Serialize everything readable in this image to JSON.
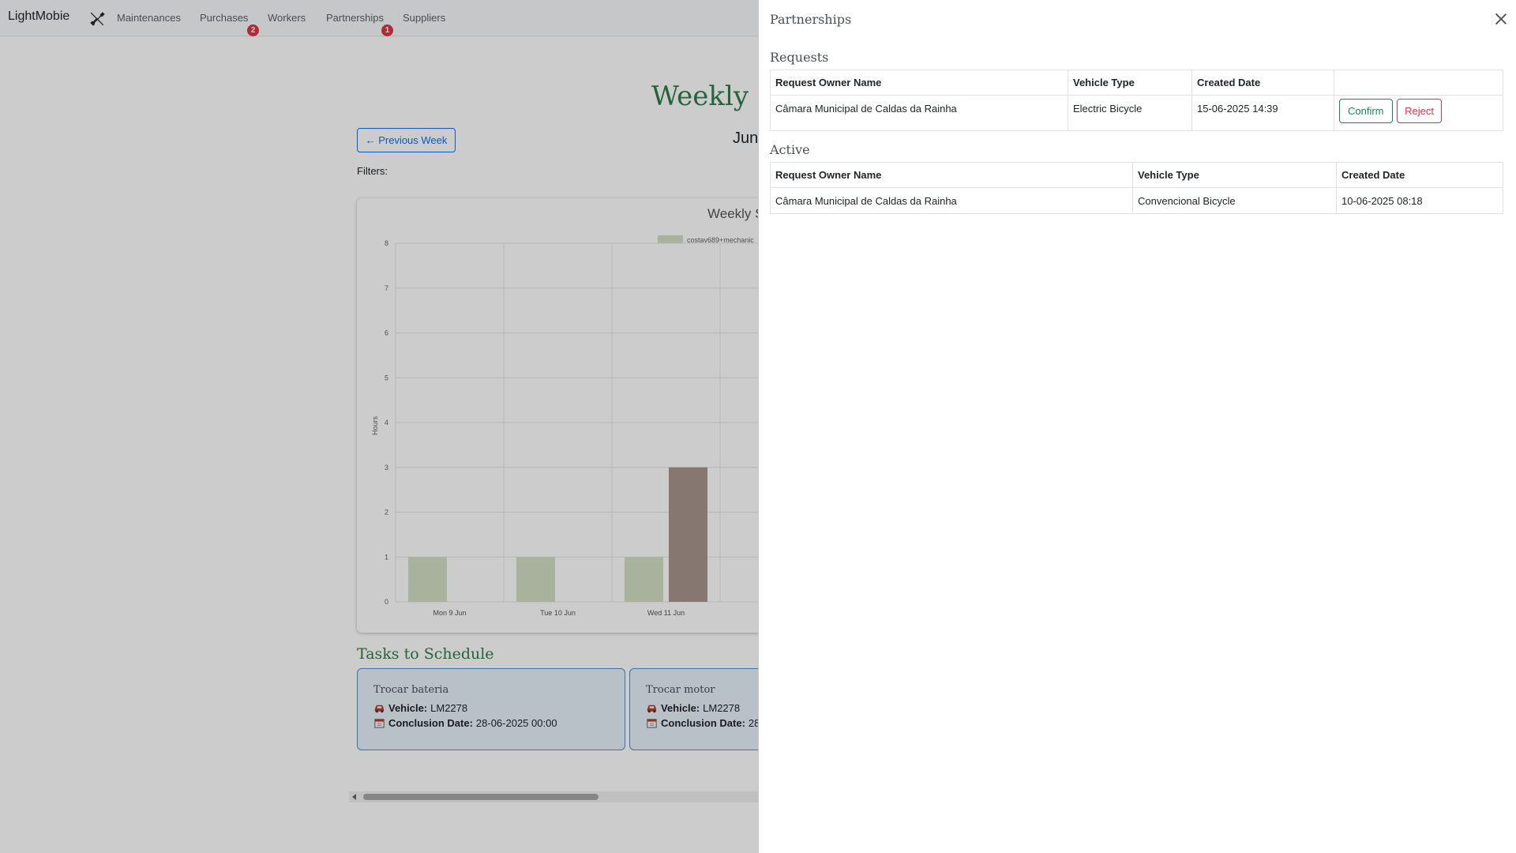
{
  "navbar": {
    "brand": "LightMobie",
    "links": [
      {
        "label": "Maintenances"
      },
      {
        "label": "Purchases",
        "badge": "2"
      },
      {
        "label": "Workers"
      },
      {
        "label": "Partnerships",
        "badge": "1"
      },
      {
        "label": "Suppliers"
      }
    ]
  },
  "main": {
    "title": "Weekly S",
    "week_range": "Jun",
    "prev_week_label": "← Previous Week",
    "filters_label": "Filters:"
  },
  "chart_data": {
    "type": "bar",
    "title": "Weekly S",
    "ylabel": "Hours",
    "ylim": [
      0,
      8
    ],
    "yticks": [
      "0",
      "1",
      "2",
      "3",
      "4",
      "5",
      "6",
      "7",
      "8"
    ],
    "categories": [
      "Mon 9 Jun",
      "Tue 10 Jun",
      "Wed 11 Jun",
      "Th"
    ],
    "series": [
      {
        "name": "costav689+mechanic",
        "values": [
          1,
          1,
          1,
          null
        ],
        "color": "#d3dfc4"
      },
      {
        "values": [
          0,
          0,
          3,
          null
        ],
        "color": "#a8968d"
      }
    ],
    "legend": "top",
    "grid": true
  },
  "tasks": {
    "title": "Tasks to Schedule",
    "vehicle_label": "Vehicle:",
    "date_label": "Conclusion Date:",
    "items": [
      {
        "name": "Trocar bateria",
        "vehicle": "LM2278",
        "date": "28-06-2025 00:00"
      },
      {
        "name": "Trocar motor",
        "vehicle": "LM2278",
        "date": "28"
      }
    ]
  },
  "panel": {
    "title": "Partnerships",
    "requests": {
      "title": "Requests",
      "headers": [
        "Request Owner Name",
        "Vehicle Type",
        "Created Date",
        ""
      ],
      "rows": [
        {
          "owner": "Câmara Municipal de Caldas da Rainha",
          "vehicle_type": "Electric Bicycle",
          "created": "15-06-2025 14:39",
          "confirm_label": "Confirm",
          "reject_label": "Reject"
        }
      ]
    },
    "active": {
      "title": "Active",
      "headers": [
        "Request Owner Name",
        "Vehicle Type",
        "Created Date"
      ],
      "rows": [
        {
          "owner": "Câmara Municipal de Caldas da Rainha",
          "vehicle_type": "Convencional Bicycle",
          "created": "10-06-2025 08:18"
        }
      ]
    }
  }
}
